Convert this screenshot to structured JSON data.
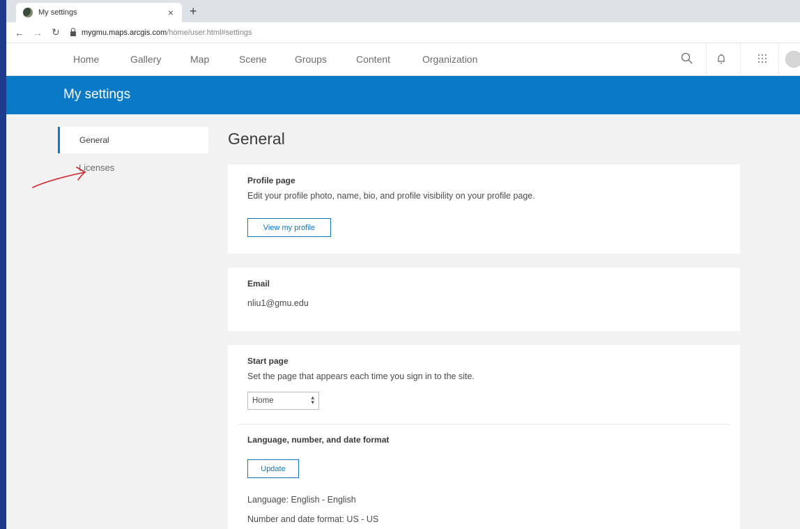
{
  "browser": {
    "tab_title": "My settings",
    "tab_close": "×",
    "new_tab": "+",
    "url_host": "mygmu.maps.arcgis.com",
    "url_path": "/home/user.html#settings"
  },
  "nav": {
    "items": [
      "Home",
      "Gallery",
      "Map",
      "Scene",
      "Groups",
      "Content",
      "Organization"
    ],
    "icons": [
      "search-icon",
      "bell-icon",
      "apps-grid-icon",
      "avatar"
    ]
  },
  "banner": {
    "title": "My settings"
  },
  "sidebar": {
    "items": [
      {
        "label": "General",
        "active": true
      },
      {
        "label": "Licenses",
        "active": false
      }
    ]
  },
  "main": {
    "title": "General",
    "profile": {
      "heading": "Profile page",
      "text": "Edit your profile photo, name, bio, and profile visibility on your profile page.",
      "button": "View my profile"
    },
    "email": {
      "heading": "Email",
      "value": "nliu1@gmu.edu"
    },
    "start_page": {
      "heading": "Start page",
      "text": "Set the page that appears each time you sign in to the site.",
      "selected": "Home"
    },
    "locale": {
      "heading": "Language, number, and date format",
      "button": "Update",
      "language": "Language: English - English",
      "number_date": "Number and date format: US - US"
    }
  },
  "colors": {
    "accent": "#0a79c6",
    "annotation": "#d2232a",
    "left_bar": "#1e3a8a"
  }
}
